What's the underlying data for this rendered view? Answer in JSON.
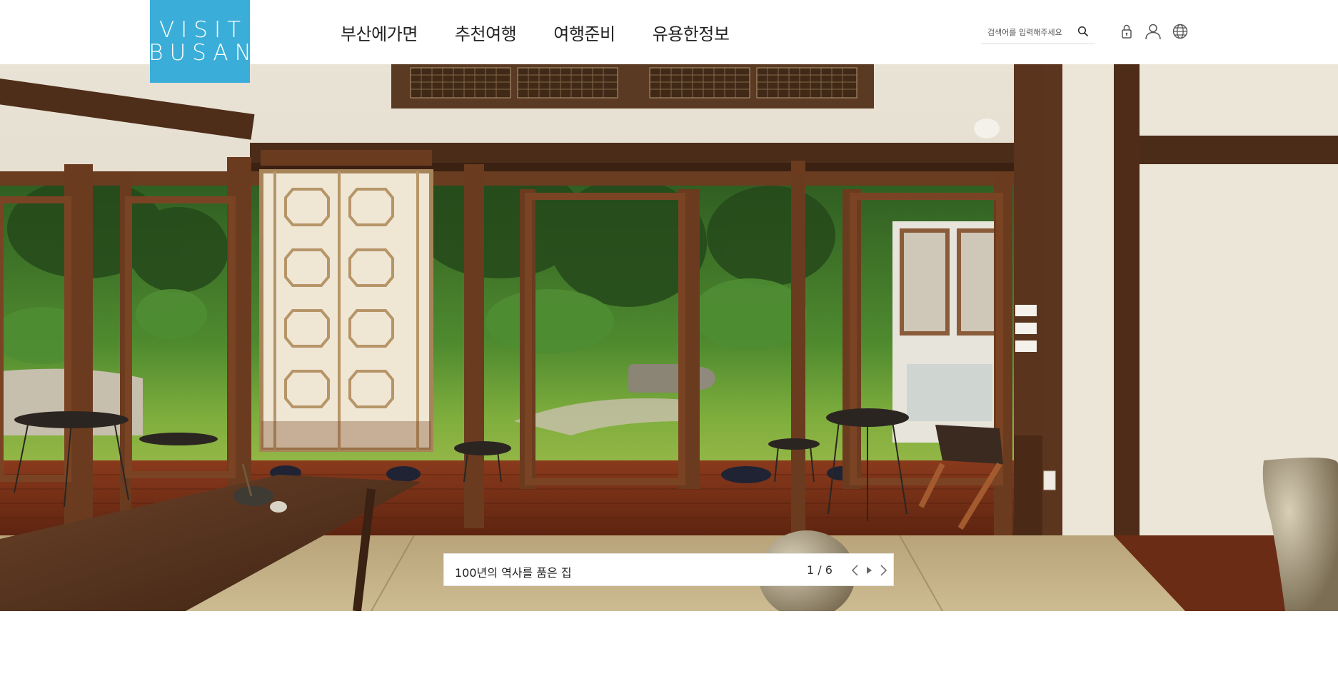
{
  "logo": {
    "line1": "VISIT",
    "line2": "BUSAN",
    "bg": "#3aaed8"
  },
  "nav": {
    "items": [
      {
        "label": "부산에가면"
      },
      {
        "label": "추천여행"
      },
      {
        "label": "여행준비"
      },
      {
        "label": "유용한정보"
      }
    ]
  },
  "search": {
    "placeholder": "검색어를 입력해주세요",
    "icon": "search-icon"
  },
  "utility": {
    "icons": [
      "lock-icon",
      "user-icon",
      "globe-icon"
    ]
  },
  "hero": {
    "caption": "100년의 역사를 품은 집",
    "counter": "1 / 6",
    "controls": [
      "chevron-left-icon",
      "play-icon",
      "chevron-right-icon"
    ]
  },
  "colors": {
    "accent": "#3aaed8",
    "text": "#222222"
  }
}
